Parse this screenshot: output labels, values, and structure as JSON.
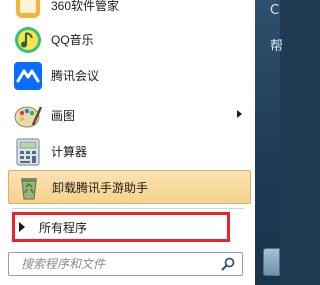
{
  "menu": {
    "items": [
      {
        "label": "360软件管家",
        "icon": "software-manager-icon"
      },
      {
        "label": "QQ音乐",
        "icon": "qq-music-icon"
      },
      {
        "label": "腾讯会议",
        "icon": "tencent-meeting-icon"
      },
      {
        "label": "画图",
        "icon": "paint-icon",
        "has_submenu": true
      },
      {
        "label": "计算器",
        "icon": "calculator-icon"
      },
      {
        "label": "卸载腾讯手游助手",
        "icon": "recycle-bin-icon",
        "highlighted": true
      }
    ],
    "all_programs": "所有程序"
  },
  "search": {
    "placeholder": "搜索程序和文件",
    "icon": "search-icon"
  },
  "right_panel": {
    "text_1": "C",
    "text_2": "帮"
  },
  "colors": {
    "highlight": "#f7d189",
    "annotation": "#e8262a",
    "panel": "#1f3a52"
  }
}
